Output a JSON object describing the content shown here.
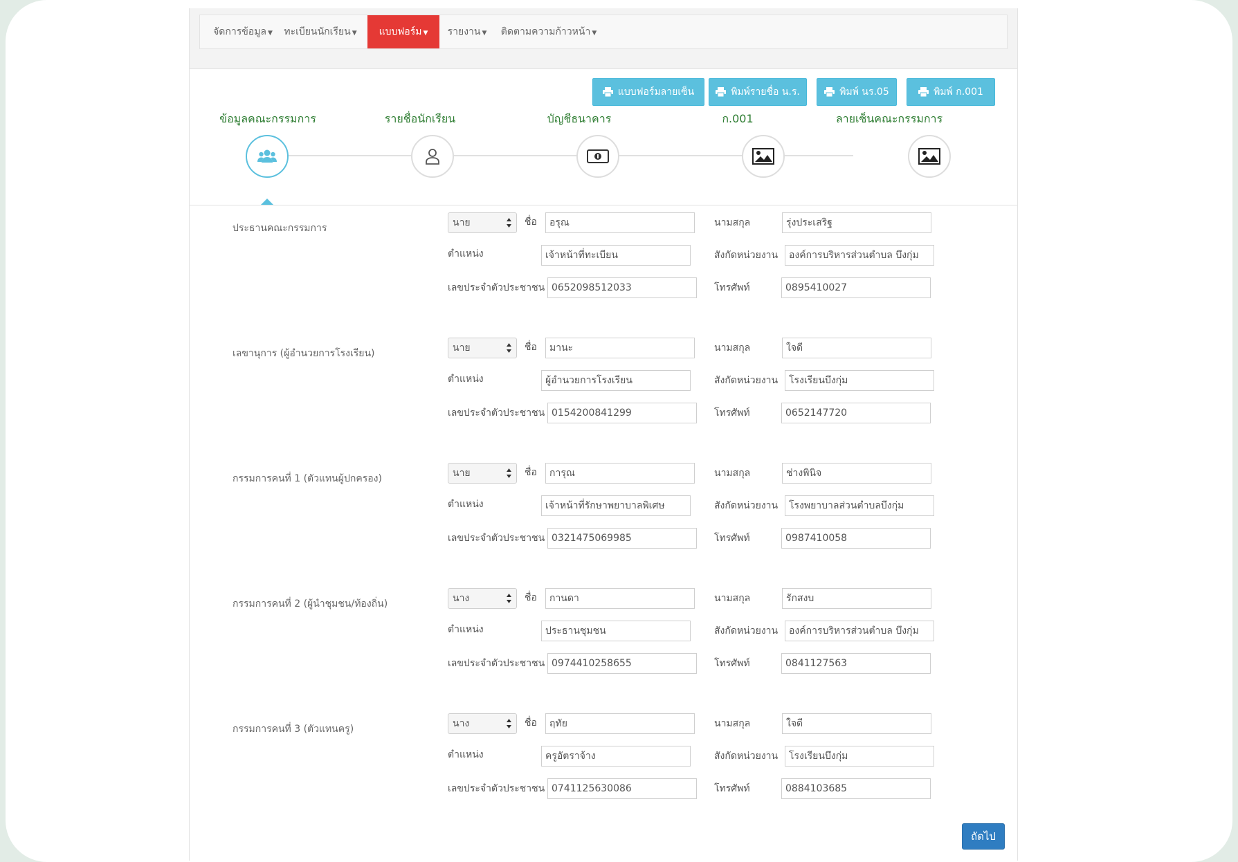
{
  "nav": {
    "items": [
      {
        "label": "จัดการข้อมูล"
      },
      {
        "label": "ทะเบียนนักเรียน"
      },
      {
        "label": "แบบฟอร์ม"
      },
      {
        "label": "รายงาน"
      },
      {
        "label": "ติดตามความก้าวหน้า"
      }
    ],
    "active_color": "#e53935"
  },
  "print_buttons": [
    {
      "label": "แบบฟอร์มลายเซ็น"
    },
    {
      "label": "พิมพ์รายชื่อ น.ร."
    },
    {
      "label": "พิมพ์ นร.05"
    },
    {
      "label": "พิมพ์ ก.001"
    }
  ],
  "steps": [
    {
      "label": "ข้อมูลคณะกรรมการ",
      "icon": "users-icon"
    },
    {
      "label": "รายชื่อนักเรียน",
      "icon": "user-icon"
    },
    {
      "label": "บัญชีธนาคาร",
      "icon": "money-icon"
    },
    {
      "label": "ก.001",
      "icon": "image-icon"
    },
    {
      "label": "ลายเซ็นคณะกรรมการ",
      "icon": "image-icon"
    }
  ],
  "labels": {
    "first_name": "ชื่อ",
    "last_name": "นามสกุล",
    "position": "ตำแหน่ง",
    "agency": "สังกัดหน่วยงาน",
    "id_card": "เลขประจำตัวประชาชน",
    "phone": "โทรศัพท์"
  },
  "committee": [
    {
      "title": "ประธานคณะกรรมการ",
      "prefix": "นาย",
      "first_name": "อรุณ",
      "last_name": "รุ่งประเสริฐ",
      "position": "เจ้าหน้าที่ทะเบียน",
      "agency": "องค์การบริหารส่วนตำบล บึงกุ่ม",
      "id_card": "0652098512033",
      "phone": "0895410027"
    },
    {
      "title": "เลขานุการ (ผู้อำนวยการโรงเรียน)",
      "prefix": "นาย",
      "first_name": "มานะ",
      "last_name": "ใจดี",
      "position": "ผู้อำนวยการโรงเรียน",
      "agency": "โรงเรียนบึงกุ่ม",
      "id_card": "0154200841299",
      "phone": "0652147720"
    },
    {
      "title": "กรรมการคนที่ 1 (ตัวแทนผู้ปกครอง)",
      "prefix": "นาย",
      "first_name": "การุณ",
      "last_name": "ช่างพินิจ",
      "position": "เจ้าหน้าที่รักษาพยาบาลพิเศษ",
      "agency": "โรงพยาบาลส่วนตำบลบึงกุ่ม",
      "id_card": "0321475069985",
      "phone": "0987410058"
    },
    {
      "title": "กรรมการคนที่ 2 (ผู้นำชุมชน/ท้องถิ่น)",
      "prefix": "นาง",
      "first_name": "กานดา",
      "last_name": "รักสงบ",
      "position": "ประธานชุมชน",
      "agency": "องค์การบริหารส่วนตำบล บึงกุ่ม",
      "id_card": "0974410258655",
      "phone": "0841127563"
    },
    {
      "title": "กรรมการคนที่ 3 (ตัวแทนครู)",
      "prefix": "นาง",
      "first_name": "ฤทัย",
      "last_name": "ใจดี",
      "position": "ครูอัตราจ้าง",
      "agency": "โรงเรียนบึงกุ่ม",
      "id_card": "0741125630086",
      "phone": "0884103685"
    }
  ],
  "next_button": {
    "label": "ถัดไป"
  },
  "colors": {
    "step_label": "#2e7d32",
    "print_button": "#5bc0de",
    "next_button": "#2f7dc1"
  }
}
